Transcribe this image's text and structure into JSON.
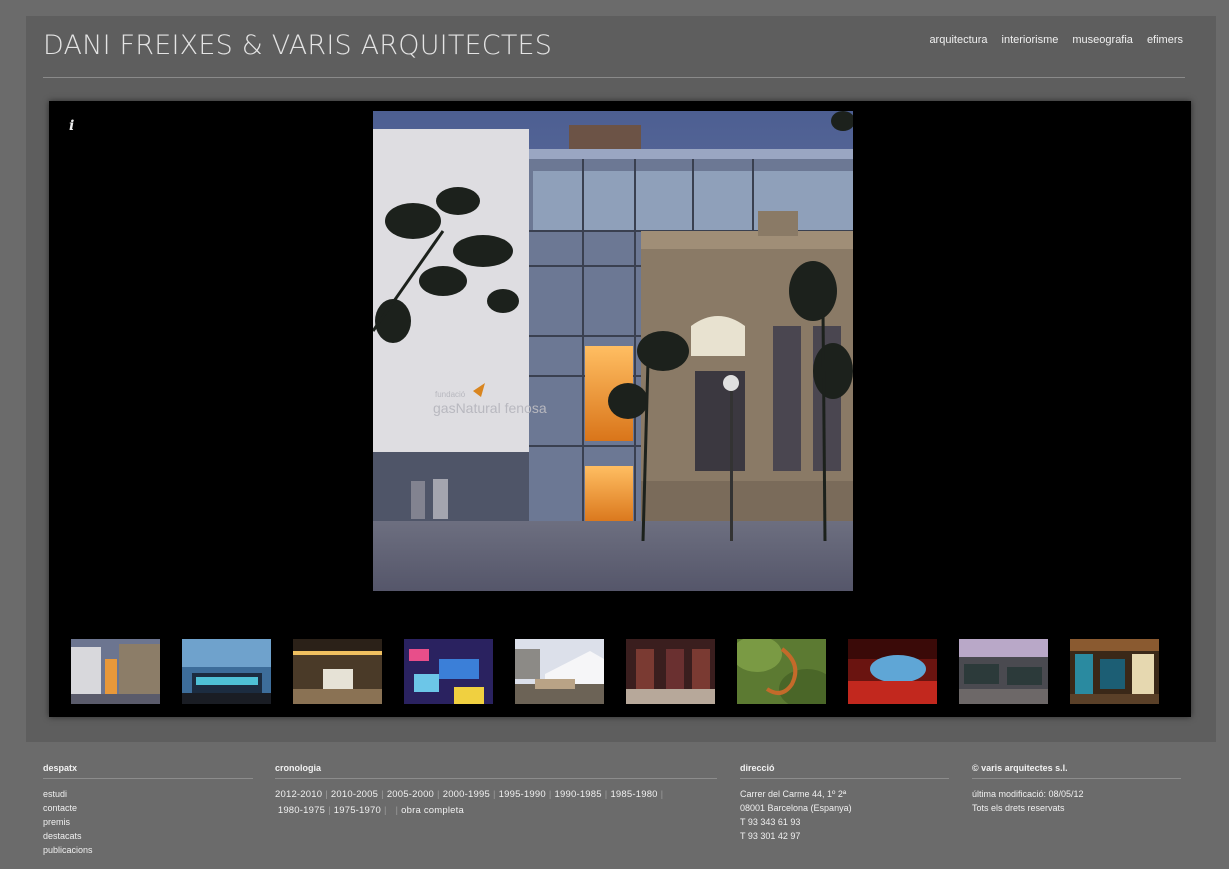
{
  "header": {
    "title": "DANI FREIXES & VARIS ARQUITECTES",
    "nav": [
      "arquitectura",
      "interiorisme",
      "museografia",
      "efimers"
    ]
  },
  "viewer": {
    "info_label": "i",
    "photo_sign": "gasNatural fenosa",
    "photo_sign_small": "fundació",
    "thumbnail_count": 10
  },
  "footer": {
    "despatx": {
      "heading": "despatx",
      "links": [
        "estudi",
        "contacte",
        "premis",
        "destacats",
        "publicacions"
      ]
    },
    "cronologia": {
      "heading": "cronologia",
      "periods": [
        "2012-2010",
        "2010-2005",
        "2005-2000",
        "2000-1995",
        "1995-1990",
        "1990-1985",
        "1985-1980",
        "1980-1975",
        "1975-1970"
      ],
      "all_works": "obra completa"
    },
    "direccio": {
      "heading": "direcció",
      "lines": [
        "Carrer del Carme 44, 1º  2ª",
        "08001 Barcelona (Espanya)",
        "T 93 343 61 93",
        "T 93 301 42 97"
      ]
    },
    "copyright": {
      "heading": "© varis arquitectes s.l.",
      "lines": [
        "última modificació: 08/05/12",
        "Tots els drets reservats"
      ]
    }
  },
  "colors": {
    "page_bg": "#6b6b6b",
    "frame_bg": "#5e5e5e",
    "viewer_bg": "#000000",
    "text": "#f0f0f0"
  }
}
